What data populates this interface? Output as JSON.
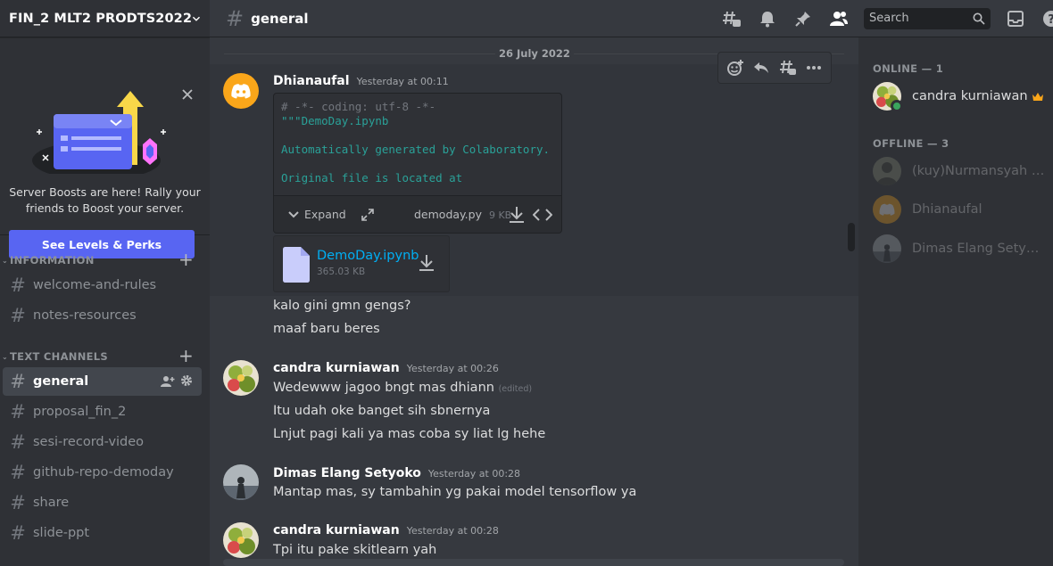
{
  "server": {
    "name": "FIN_2 MLT2 PRODTS2022"
  },
  "boost": {
    "text_line1": "Server Boosts are here! Rally your",
    "text_line2": "friends to Boost your server.",
    "button": "See Levels & Perks"
  },
  "categories": {
    "information": "INFORMATION",
    "text_channels": "TEXT CHANNELS"
  },
  "channels": {
    "info": [
      "welcome-and-rules",
      "notes-resources"
    ],
    "text": [
      "general",
      "proposal_fin_2",
      "sesi-record-video",
      "github-repo-demoday",
      "share",
      "slide-ppt"
    ]
  },
  "topbar": {
    "channel": "general",
    "search_placeholder": "Search"
  },
  "chat": {
    "date_divider": "26 July 2022",
    "messages": [
      {
        "author": "Dhianaufal",
        "time": "Yesterday at 00:11",
        "code": {
          "line1": "# -*- coding: utf-8 -*-",
          "line2": "\"\"\"DemoDay.ipynb",
          "line3": "Automatically generated by Colaboratory.",
          "line4": "Original file is located at",
          "expand": "Expand",
          "filename": "demoday.py",
          "filesize": "9 KB"
        },
        "attachment": {
          "name": "DemoDay.ipynb",
          "size": "365.03 KB"
        },
        "lines": [
          "kalo gini gmn gengs?",
          "maaf baru beres"
        ]
      },
      {
        "author": "candra kurniawan",
        "time": "Yesterday at 00:26",
        "lines": [
          "Wedewww jagoo bngt mas dhiann",
          "Itu udah oke banget sih sbnernya",
          "Lnjut pagi kali ya mas coba sy liat lg hehe"
        ],
        "edited": "(edited)"
      },
      {
        "author": "Dimas Elang Setyoko",
        "time": "Yesterday at 00:28",
        "lines": [
          "Mantap mas, sy tambahin yg pakai model tensorflow ya"
        ]
      },
      {
        "author": "candra kurniawan",
        "time": "Yesterday at 00:28",
        "lines": [
          "Tpi itu pake skitlearn yah"
        ]
      }
    ]
  },
  "members": {
    "online_header": "ONLINE — 1",
    "offline_header": "OFFLINE — 3",
    "online": [
      "candra kurniawan"
    ],
    "offline": [
      "(kuy)Nurmansyah Am...",
      "Dhianaufal",
      "Dimas Elang Setyoko"
    ]
  },
  "colors": {
    "accent": "#5865f2",
    "online": "#3ba55d",
    "link": "#00aff4",
    "discord_avatar": "#faa61a"
  }
}
